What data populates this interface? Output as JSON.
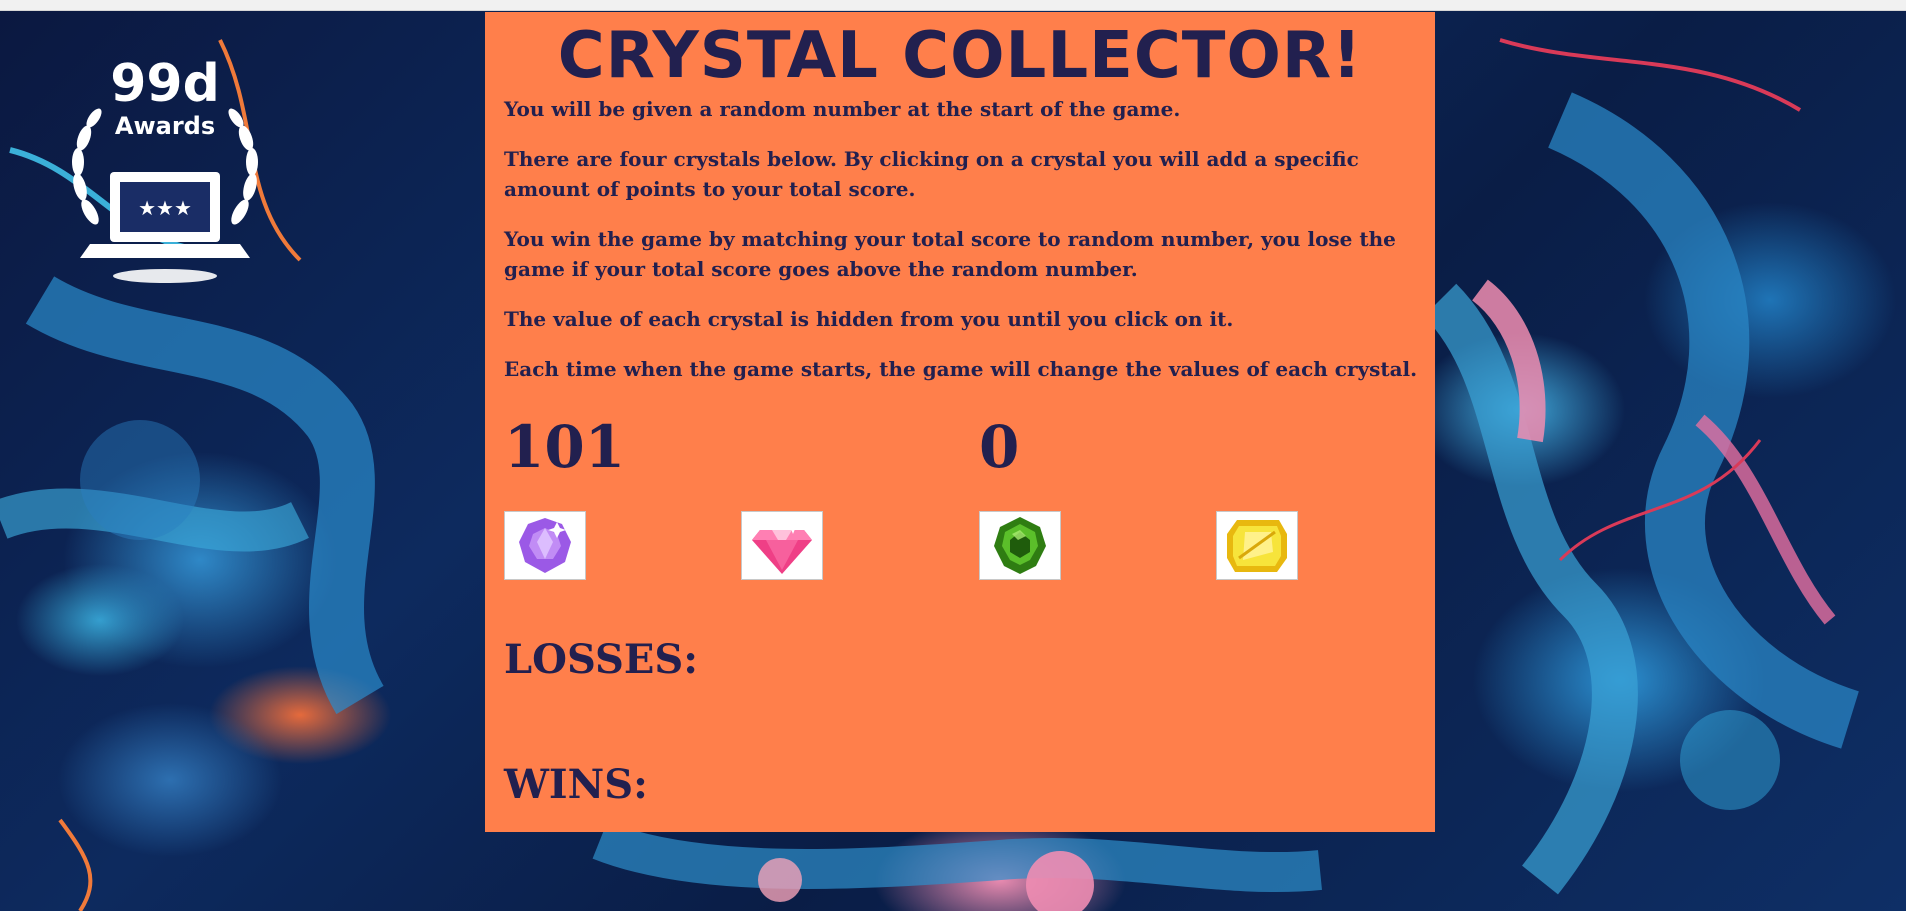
{
  "award_logo": {
    "brand": "99d",
    "subtitle": "Awards"
  },
  "game": {
    "title": "CRYSTAL COLLECTOR!",
    "rules": [
      "You will be given a random number at the start of the game.",
      "There are four crystals below. By clicking on a crystal you will add a specific amount of points to your total score.",
      "You win the game by matching your total score to random number, you lose the game if your total score goes above the random number.",
      "The value of each crystal is hidden from you until you click on it.",
      "Each time when the game starts, the game will change the values of each crystal."
    ],
    "random_number": "101",
    "total_score": "0",
    "crystals": [
      {
        "icon": "purple-crystal-icon",
        "color": "#9b59e6"
      },
      {
        "icon": "pink-crystal-icon",
        "color": "#ef3f86"
      },
      {
        "icon": "green-crystal-icon",
        "color": "#3f9b1f"
      },
      {
        "icon": "yellow-crystal-icon",
        "color": "#f2d21b"
      }
    ],
    "losses_label": "LOSSES:",
    "wins_label": "WINS:"
  },
  "colors": {
    "panel": "#ff7f4b",
    "text": "#22204f"
  }
}
